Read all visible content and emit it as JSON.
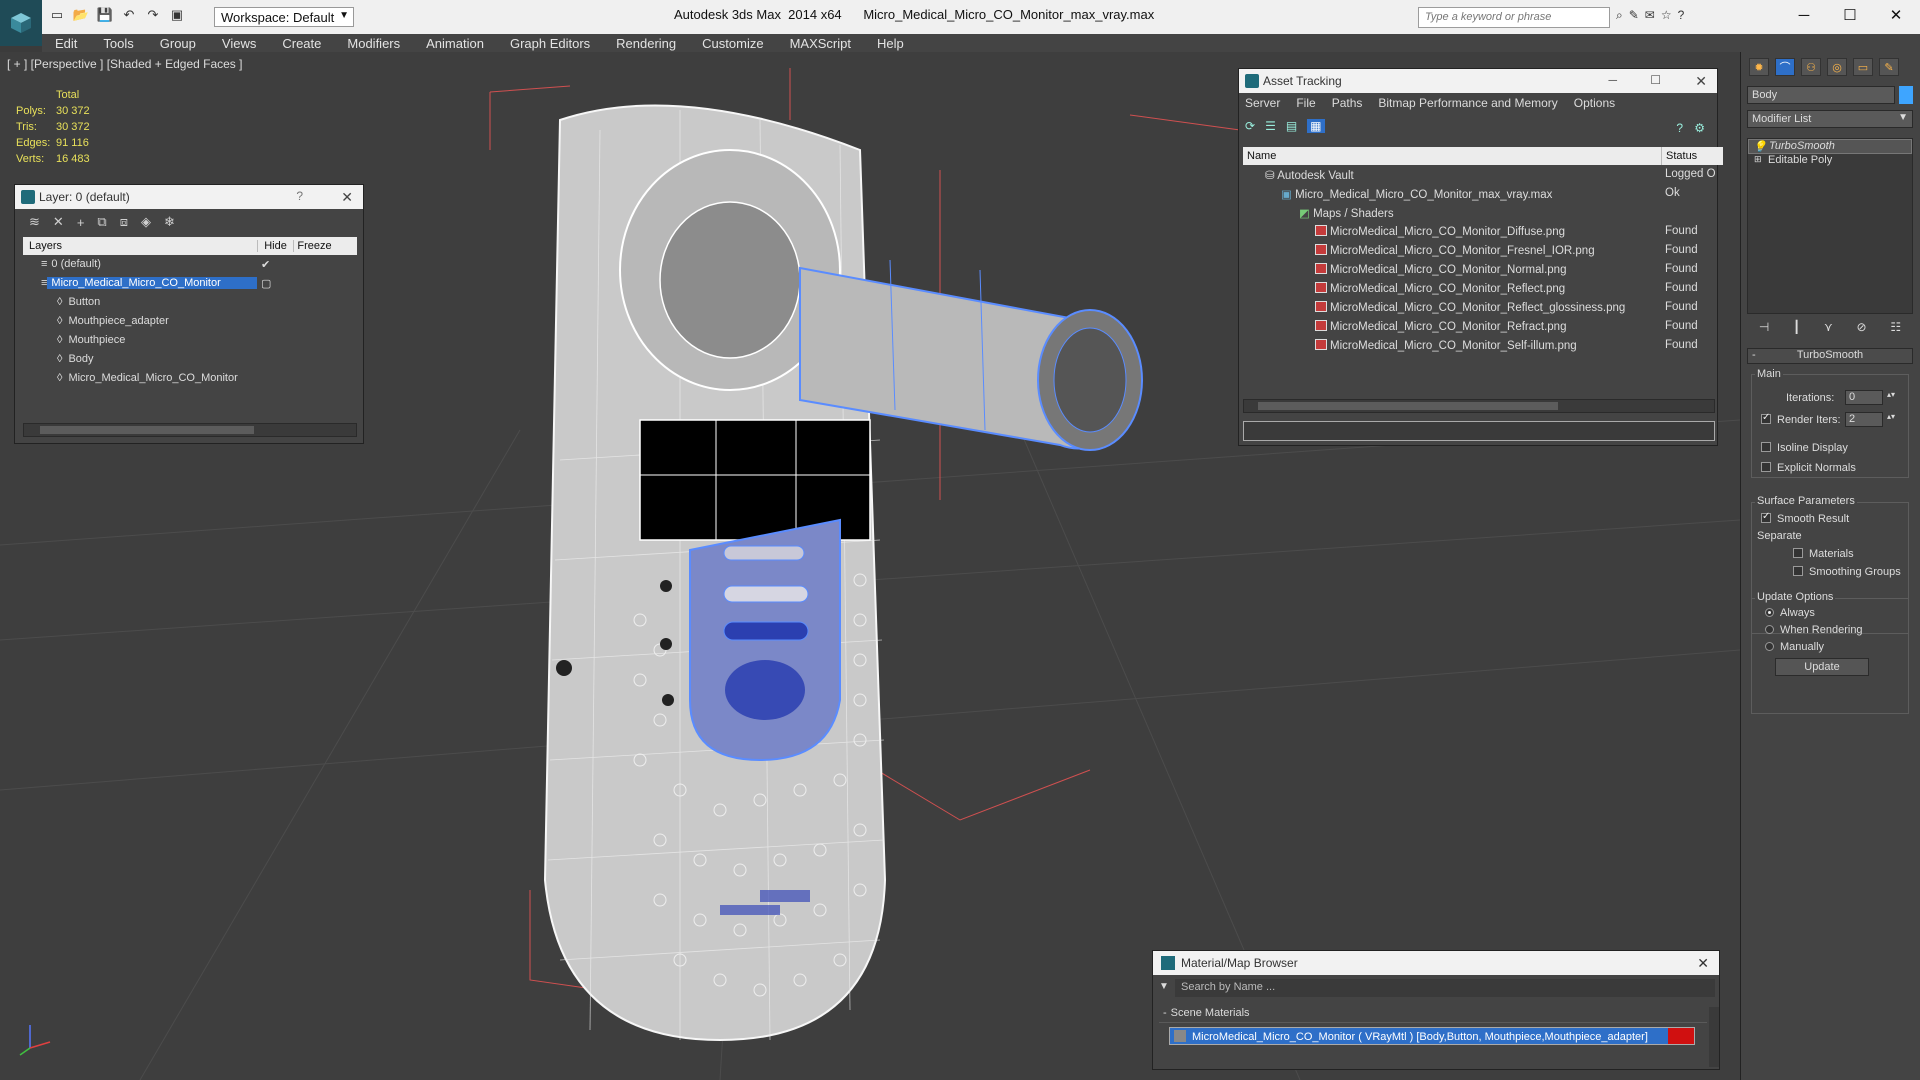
{
  "app": {
    "title": "Autodesk 3ds Max  2014 x64      Micro_Medical_Micro_CO_Monitor_max_vray.max",
    "workspace": "Workspace: Default",
    "search_placeholder": "Type a keyword or phrase"
  },
  "menu": [
    "Edit",
    "Tools",
    "Group",
    "Views",
    "Create",
    "Modifiers",
    "Animation",
    "Graph Editors",
    "Rendering",
    "Customize",
    "MAXScript",
    "Help"
  ],
  "viewport": {
    "label": "[ + ] [Perspective ] [Shaded + Edged Faces ]",
    "stats": {
      "header": "Total",
      "polys_label": "Polys:",
      "polys": "30 372",
      "tris_label": "Tris:",
      "tris": "30 372",
      "edges_label": "Edges:",
      "edges": "91 116",
      "verts_label": "Verts:",
      "verts": "16 483"
    }
  },
  "layer_panel": {
    "title": "Layer: 0 (default)",
    "help": "?",
    "col_layers": "Layers",
    "col_hide": "Hide",
    "col_freeze": "Freeze",
    "rows": [
      {
        "name": "0 (default)"
      },
      {
        "name": "Micro_Medical_Micro_CO_Monitor"
      },
      {
        "name": "Button"
      },
      {
        "name": "Mouthpiece_adapter"
      },
      {
        "name": "Mouthpiece"
      },
      {
        "name": "Body"
      },
      {
        "name": "Micro_Medical_Micro_CO_Monitor"
      }
    ]
  },
  "asset_tracking": {
    "title": "Asset Tracking",
    "menu": [
      "Server",
      "File",
      "Paths",
      "Bitmap Performance and Memory",
      "Options"
    ],
    "col_name": "Name",
    "col_status": "Status",
    "rows": [
      {
        "name": "Autodesk Vault",
        "status": "Logged O"
      },
      {
        "name": "Micro_Medical_Micro_CO_Monitor_max_vray.max",
        "status": "Ok"
      },
      {
        "name": "Maps / Shaders",
        "status": ""
      },
      {
        "name": "MicroMedical_Micro_CO_Monitor_Diffuse.png",
        "status": "Found"
      },
      {
        "name": "MicroMedical_Micro_CO_Monitor_Fresnel_IOR.png",
        "status": "Found"
      },
      {
        "name": "MicroMedical_Micro_CO_Monitor_Normal.png",
        "status": "Found"
      },
      {
        "name": "MicroMedical_Micro_CO_Monitor_Reflect.png",
        "status": "Found"
      },
      {
        "name": "MicroMedical_Micro_CO_Monitor_Reflect_glossiness.png",
        "status": "Found"
      },
      {
        "name": "MicroMedical_Micro_CO_Monitor_Refract.png",
        "status": "Found"
      },
      {
        "name": "MicroMedical_Micro_CO_Monitor_Self-illum.png",
        "status": "Found"
      }
    ]
  },
  "material_browser": {
    "title": "Material/Map Browser",
    "search_placeholder": "Search by Name ...",
    "section": "Scene Materials",
    "item": "MicroMedical_Micro_CO_Monitor  ( VRayMtl ) [Body,Button, Mouthpiece,Mouthpiece_adapter]"
  },
  "command_panel": {
    "object_name": "Body",
    "modifier_list": "Modifier List",
    "stack": [
      "TurboSmooth",
      "Editable Poly"
    ],
    "rollout_title": "TurboSmooth",
    "main_label": "Main",
    "iterations_label": "Iterations:",
    "iterations": "0",
    "render_iters_label": "Render Iters:",
    "render_iters": "2",
    "isoline": "Isoline Display",
    "explicit_normals": "Explicit Normals",
    "surface_params": "Surface Parameters",
    "smooth_result": "Smooth Result",
    "separate": "Separate",
    "materials": "Materials",
    "smoothing_groups": "Smoothing Groups",
    "update_options": "Update Options",
    "always": "Always",
    "when_rendering": "When Rendering",
    "manually": "Manually",
    "update_btn": "Update"
  },
  "colors": {
    "accent": "#2e6fc8",
    "viewport_bg": "#3e3e3e",
    "wire": "#ffffff",
    "selection_wire": "#5a8cff"
  }
}
